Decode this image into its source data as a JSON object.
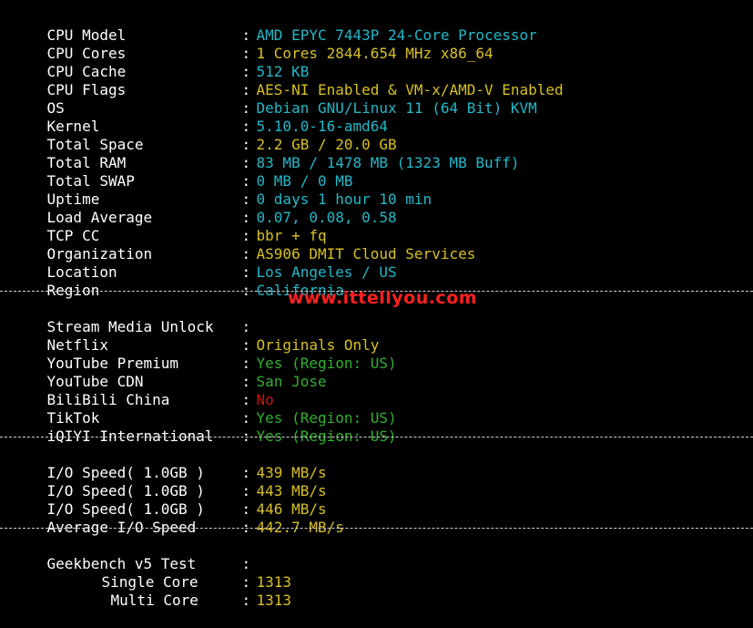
{
  "colors": {
    "cyan": "#22b8c8",
    "yellow": "#d8c020",
    "green": "#30b030",
    "red": "#cc1010",
    "background": "#000000",
    "watermark": "#ff2020"
  },
  "watermark": "www.ittellyou.com",
  "separator": ":",
  "system": [
    {
      "label": "CPU Model",
      "value": "AMD EPYC 7443P 24-Core Processor"
    },
    {
      "label": "CPU Cores",
      "value": "1 Cores 2844.654 MHz x86_64"
    },
    {
      "label": "CPU Cache",
      "value": "512 KB"
    },
    {
      "label": "CPU Flags",
      "value": "AES-NI Enabled & VM-x/AMD-V Enabled"
    },
    {
      "label": "OS",
      "value": "Debian GNU/Linux 11 (64 Bit) KVM"
    },
    {
      "label": "Kernel",
      "value": "5.10.0-16-amd64"
    },
    {
      "label": "Total Space",
      "value": "2.2 GB / 20.0 GB"
    },
    {
      "label": "Total RAM",
      "value": "83 MB / 1478 MB (1323 MB Buff)"
    },
    {
      "label": "Total SWAP",
      "value": "0 MB / 0 MB"
    },
    {
      "label": "Uptime",
      "value": "0 days 1 hour 10 min"
    },
    {
      "label": "Load Average",
      "value": "0.07, 0.08, 0.58"
    },
    {
      "label": "TCP CC",
      "value": "bbr + fq"
    },
    {
      "label": "Organization",
      "value": "AS906 DMIT Cloud Services"
    },
    {
      "label": "Location",
      "value": "Los Angeles / US"
    },
    {
      "label": "Region",
      "value": "California"
    }
  ],
  "stream": {
    "header": "Stream Media Unlock",
    "items": [
      {
        "label": "Netflix",
        "value": "Originals Only"
      },
      {
        "label": "YouTube Premium",
        "value": "Yes (Region: US)"
      },
      {
        "label": "YouTube CDN",
        "value": "San Jose"
      },
      {
        "label": "BiliBili China",
        "value": "No"
      },
      {
        "label": "TikTok",
        "value": "Yes (Region: US)"
      },
      {
        "label": "iQIYI International",
        "value": "Yes (Region: US)"
      }
    ]
  },
  "io": [
    {
      "label": "I/O Speed( 1.0GB )",
      "value": "439 MB/s"
    },
    {
      "label": "I/O Speed( 1.0GB )",
      "value": "443 MB/s"
    },
    {
      "label": "I/O Speed( 1.0GB )",
      "value": "446 MB/s"
    },
    {
      "label": "Average I/O Speed",
      "value": "442.7 MB/s"
    }
  ],
  "geekbench": {
    "header": "Geekbench v5 Test",
    "single_label": "Single Core",
    "single_value": "1313",
    "multi_label": "Multi Core",
    "multi_value": "1313"
  }
}
